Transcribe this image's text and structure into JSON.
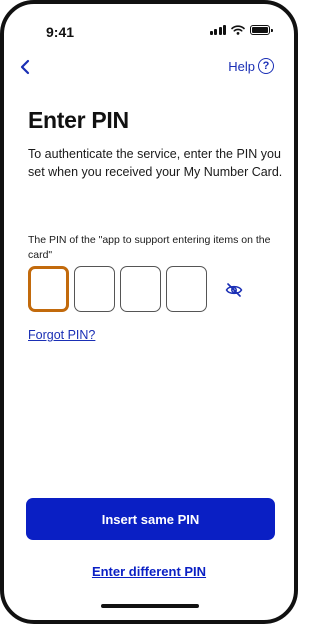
{
  "status_bar": {
    "time": "9:41"
  },
  "nav": {
    "back_icon": "chevron-left-icon",
    "help_label": "Help",
    "help_icon_glyph": "?"
  },
  "content": {
    "title": "Enter PIN",
    "description": "To authenticate the service, enter the PIN you set when you received your My Number Card.",
    "pin_label": "The PIN of the \"app to support entering items on the card\"",
    "pin_length": 4,
    "pin_active_index": 0,
    "visibility_toggle_icon": "eye-slash-icon",
    "forgot_link": "Forgot PIN?"
  },
  "actions": {
    "primary_button": "Insert same PIN",
    "secondary_link": "Enter different PIN"
  },
  "colors": {
    "accent": "#0a1fc4",
    "link": "#1a2fb5",
    "active_border": "#c26a0c",
    "text": "#111111"
  }
}
